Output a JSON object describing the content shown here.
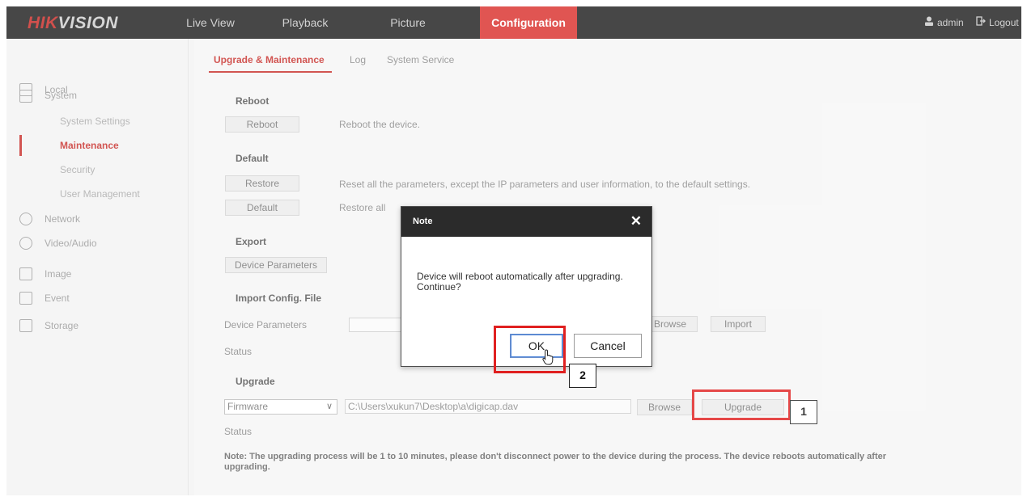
{
  "brand": {
    "logo_red": "HIK",
    "logo_rest": "VISION"
  },
  "top_nav": {
    "tabs": [
      "Live View",
      "Playback",
      "Picture",
      "Configuration"
    ],
    "active": "Configuration",
    "user_label": "admin",
    "logout_label": "Logout"
  },
  "sidebar": {
    "local": "Local",
    "system": "System",
    "system_settings": "System Settings",
    "maintenance": "Maintenance",
    "security": "Security",
    "user_management": "User Management",
    "network": "Network",
    "video_audio": "Video/Audio",
    "image": "Image",
    "event": "Event",
    "storage": "Storage"
  },
  "subtabs": [
    "Upgrade & Maintenance",
    "Log",
    "System Service"
  ],
  "reboot": {
    "heading": "Reboot",
    "button": "Reboot",
    "desc": "Reboot the device."
  },
  "default": {
    "heading": "Default",
    "restore_button": "Restore",
    "restore_desc": "Reset all the parameters, except the IP parameters and user information, to the default settings.",
    "default_button": "Default",
    "default_desc": "Restore all"
  },
  "export": {
    "heading": "Export",
    "button": "Device Parameters"
  },
  "import": {
    "heading": "Import Config. File",
    "device_params_label": "Device Parameters",
    "status_label": "Status",
    "browse_button": "Browse",
    "import_button": "Import"
  },
  "upgrade": {
    "heading": "Upgrade",
    "select_value": "Firmware",
    "path_value": "C:\\Users\\xukun7\\Desktop\\a\\digicap.dav",
    "browse_button": "Browse",
    "upgrade_button": "Upgrade",
    "status_label": "Status",
    "note_line1": "Note: The upgrading process will be 1 to 10 minutes, please don't disconnect power to the device during the process. The device reboots automatically after",
    "note_line2": "upgrading."
  },
  "dialog": {
    "title": "Note",
    "close_glyph": "✕",
    "message_line1": "Device will reboot automatically after upgrading.",
    "message_line2": "Continue?",
    "ok_label": "OK",
    "cancel_label": "Cancel"
  },
  "annotations": {
    "step1": "1",
    "step2": "2"
  },
  "colors": {
    "accent": "#d9302c",
    "topbar": "#1f1f1f",
    "highlight": "#e02020"
  }
}
